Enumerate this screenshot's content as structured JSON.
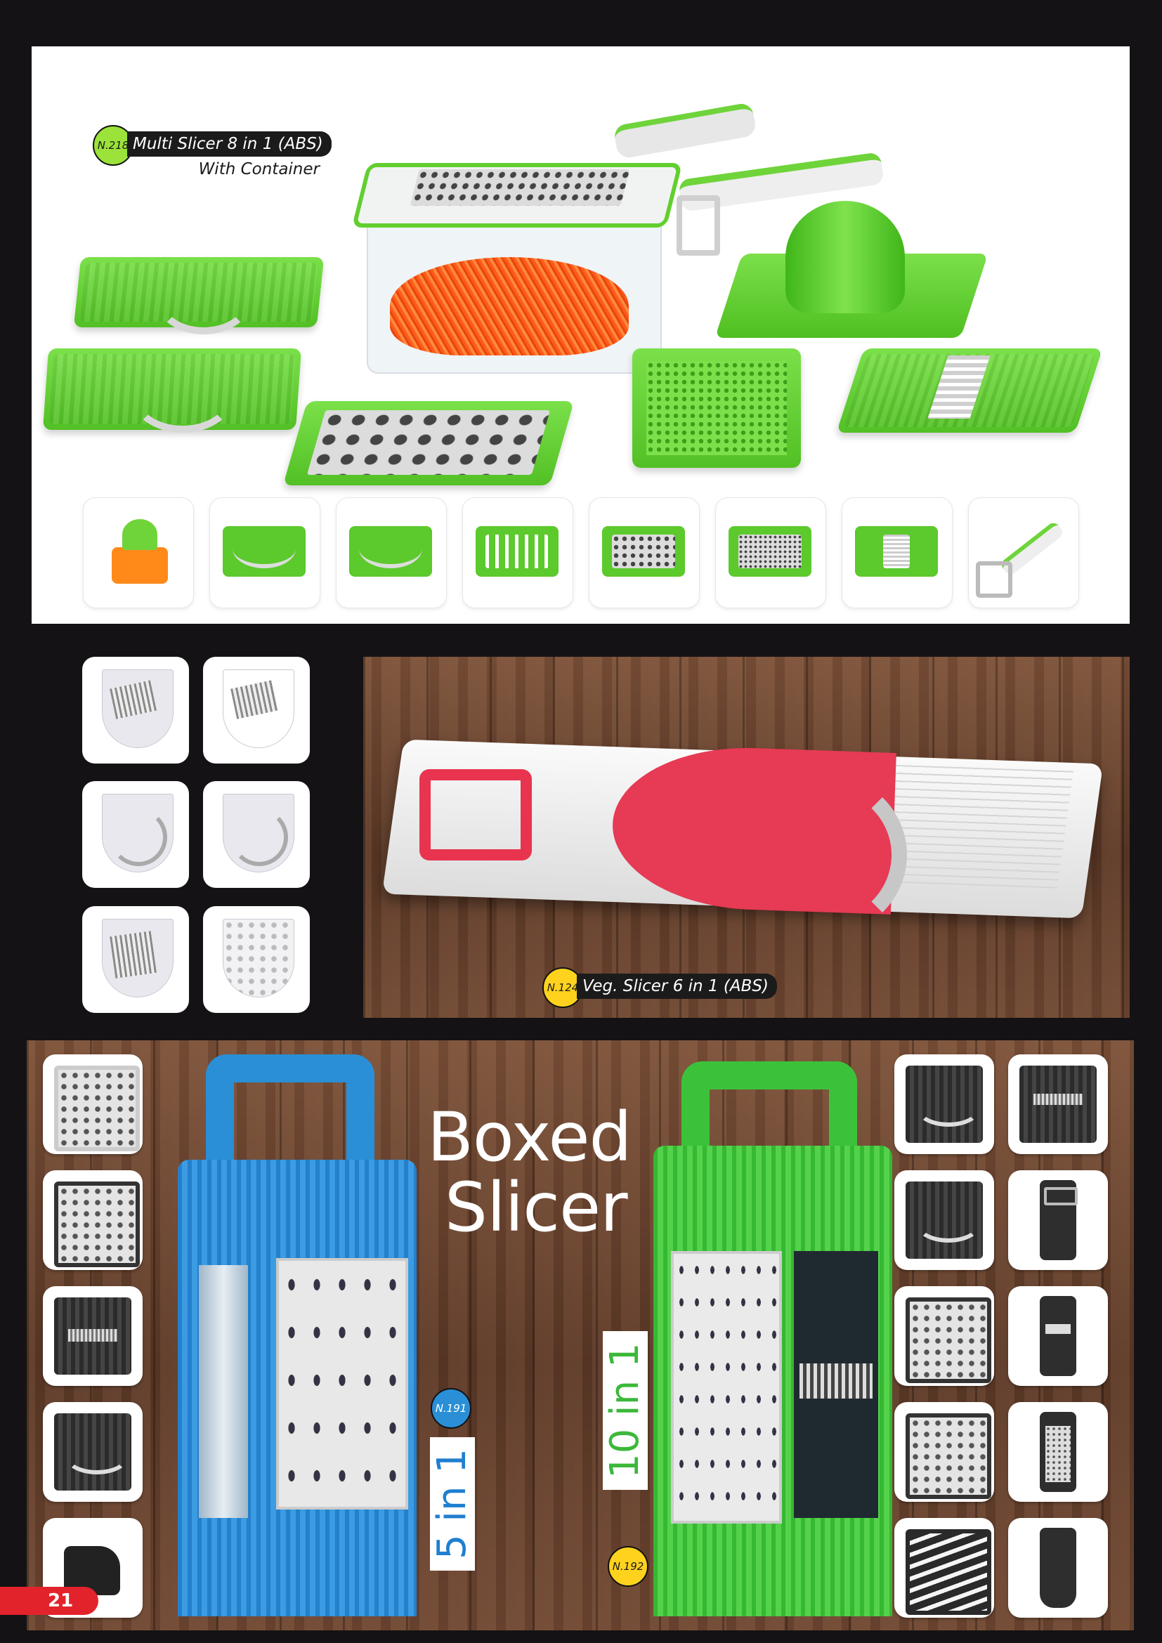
{
  "top_panel": {
    "product_code": "N.218",
    "product_name": "Multi Slicer 8 in 1 (ABS)",
    "product_subtitle": "With Container"
  },
  "middle_panel": {
    "product_code": "N.124",
    "product_name": "Veg. Slicer 6 in 1 (ABS)"
  },
  "bottom_panel": {
    "title_line1": "Boxed",
    "title_line2": "Slicer",
    "blue": {
      "product_code": "N.191",
      "label": "5 in 1"
    },
    "green": {
      "product_code": "N.192",
      "label": "10 in 1"
    }
  },
  "page_number": "21",
  "colors": {
    "lime_badge": "#9be23a",
    "blue_badge": "#2a8fd6",
    "yellow_badge": "#ffd21e",
    "blue_label": "#1f7fd0",
    "green_label": "#3cb83a",
    "page_tab": "#e3232c"
  }
}
